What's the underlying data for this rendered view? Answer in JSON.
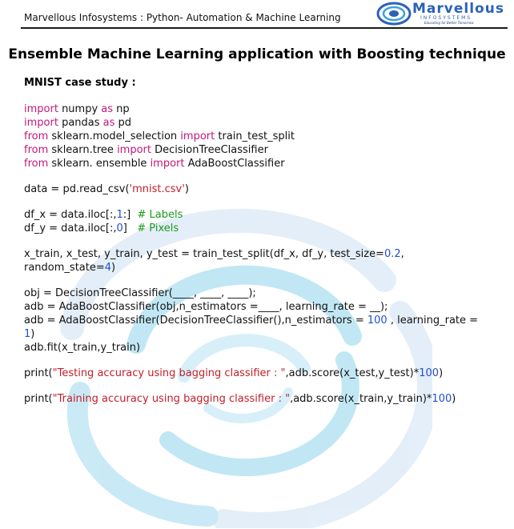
{
  "header": {
    "left_text": "Marvellous Infosystems : Python- Automation & Machine Learning",
    "logo": {
      "name": "Marvellous",
      "subtitle": "INFOSYSTEMS",
      "tagline": "Educating for Better Tomorrow",
      "icon": "swirl-logo-icon"
    }
  },
  "title": "Ensemble Machine Learning application with Boosting technique",
  "subtitle": "MNIST case study :",
  "colors": {
    "keyword": "#c2187a",
    "string": "#c0202a",
    "number": "#1f4fcf",
    "comment": "#1a9a1a",
    "brand": "#2b62b5"
  },
  "code": {
    "l1": [
      "import",
      " numpy ",
      "as",
      " np"
    ],
    "l2": [
      "import",
      " pandas ",
      "as",
      " pd"
    ],
    "l3": [
      "from",
      " sklearn.model_selection ",
      "import",
      " train_test_split"
    ],
    "l4": [
      "from",
      " sklearn.tree ",
      "import",
      " DecisionTreeClassifier"
    ],
    "l5": [
      "from",
      " sklearn. ensemble ",
      "import",
      " AdaBoostClassifier"
    ],
    "l6": [
      "data = pd.read_csv(",
      "'mnist.csv'",
      ")"
    ],
    "l7": [
      "df_x = data.iloc[:,",
      "1",
      ":]  ",
      "# Labels"
    ],
    "l8": [
      "df_y = data.iloc[:,",
      "0",
      "]   ",
      "# Pixels"
    ],
    "l9": [
      "x_train, x_test, y_train, y_test = train_test_split(df_x, df_y, test_size=",
      "0.2",
      ","
    ],
    "l10": [
      "random_state=",
      "4",
      ")"
    ],
    "l11": "obj = DecisionTreeClassifier(____, ____, ____);",
    "l12": "adb = AdaBoostClassifier(obj,n_estimators =____, learning_rate = __);",
    "l13": [
      "adb = AdaBoostClassifier(DecisionTreeClassifier(),n_estimators = ",
      "100",
      " , learning_rate ="
    ],
    "l14": [
      "1",
      ")"
    ],
    "l15": "adb.fit(x_train,y_train)",
    "l16": [
      "print(",
      "\"Testing accuracy using bagging classifier : \"",
      ",adb.score(x_test,y_test)*",
      "100",
      ")"
    ],
    "l17": [
      "print(",
      "\"Training accuracy using bagging classifier : \"",
      ",adb.score(x_train,y_train)*",
      "100",
      ")"
    ]
  }
}
